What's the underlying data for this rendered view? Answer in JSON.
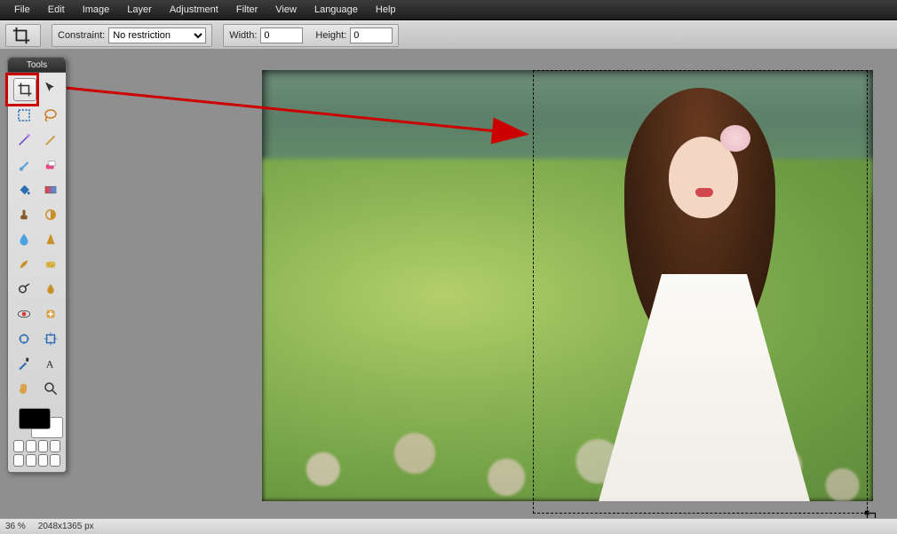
{
  "menubar": {
    "items": [
      "File",
      "Edit",
      "Image",
      "Layer",
      "Adjustment",
      "Filter",
      "View",
      "Language",
      "Help"
    ]
  },
  "optionsbar": {
    "constraint_label": "Constraint:",
    "constraint_value": "No restriction",
    "width_label": "Width:",
    "width_value": "0",
    "height_label": "Height:",
    "height_value": "0"
  },
  "tools_panel": {
    "title": "Tools",
    "tools": [
      {
        "name": "crop-tool",
        "selected": true
      },
      {
        "name": "move-tool"
      },
      {
        "name": "marquee-tool"
      },
      {
        "name": "lasso-tool"
      },
      {
        "name": "wand-tool"
      },
      {
        "name": "pencil-tool"
      },
      {
        "name": "brush-tool"
      },
      {
        "name": "eraser-tool"
      },
      {
        "name": "paint-bucket-tool"
      },
      {
        "name": "gradient-tool"
      },
      {
        "name": "clone-stamp-tool"
      },
      {
        "name": "color-replace-tool"
      },
      {
        "name": "blur-tool"
      },
      {
        "name": "sharpen-tool"
      },
      {
        "name": "smudge-tool"
      },
      {
        "name": "sponge-tool"
      },
      {
        "name": "dodge-tool"
      },
      {
        "name": "burn-tool"
      },
      {
        "name": "red-eye-tool"
      },
      {
        "name": "spot-heal-tool"
      },
      {
        "name": "bloat-tool"
      },
      {
        "name": "pinch-tool"
      },
      {
        "name": "eyedropper-tool"
      },
      {
        "name": "type-tool"
      },
      {
        "name": "hand-tool"
      },
      {
        "name": "zoom-tool"
      }
    ]
  },
  "statusbar": {
    "zoom": "36 %",
    "dimensions": "2048x1365 px"
  },
  "annotation": {
    "arrow_from": "crop-tool-in-palette",
    "arrow_to": "canvas-crop-selection"
  }
}
